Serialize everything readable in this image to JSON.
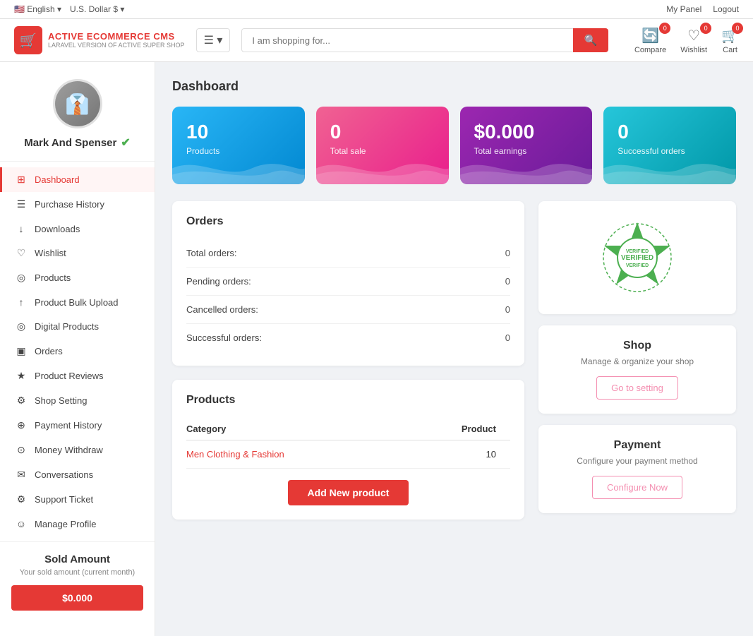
{
  "topbar": {
    "language": "English",
    "currency": "U.S. Dollar $",
    "my_panel": "My Panel",
    "logout": "Logout"
  },
  "header": {
    "brand": "ACTIVE ECOMMERCE CMS",
    "sub": "LARAVEL VERSION OF ACTIVE SUPER SHOP",
    "search_placeholder": "I am shopping for...",
    "compare_label": "Compare",
    "wishlist_label": "Wishlist",
    "cart_label": "Cart",
    "compare_count": "0",
    "wishlist_count": "0",
    "cart_count": "0"
  },
  "sidebar": {
    "username": "Mark And Spenser",
    "nav_items": [
      {
        "label": "Dashboard",
        "icon": "⊞",
        "active": true
      },
      {
        "label": "Purchase History",
        "icon": "☰",
        "active": false
      },
      {
        "label": "Downloads",
        "icon": "↓",
        "active": false
      },
      {
        "label": "Wishlist",
        "icon": "♡",
        "active": false
      },
      {
        "label": "Products",
        "icon": "◎",
        "active": false
      },
      {
        "label": "Product Bulk Upload",
        "icon": "↑",
        "active": false
      },
      {
        "label": "Digital Products",
        "icon": "◎",
        "active": false
      },
      {
        "label": "Orders",
        "icon": "▣",
        "active": false
      },
      {
        "label": "Product Reviews",
        "icon": "★",
        "active": false
      },
      {
        "label": "Shop Setting",
        "icon": "⚙",
        "active": false
      },
      {
        "label": "Payment History",
        "icon": "⊕",
        "active": false
      },
      {
        "label": "Money Withdraw",
        "icon": "⊙",
        "active": false
      },
      {
        "label": "Conversations",
        "icon": "✉",
        "active": false
      },
      {
        "label": "Support Ticket",
        "icon": "⚙",
        "active": false
      },
      {
        "label": "Manage Profile",
        "icon": "☺",
        "active": false
      }
    ],
    "sold_amount_title": "Sold Amount",
    "sold_amount_sub": "Your sold amount (current month)",
    "sold_amount_value": "$0.000"
  },
  "dashboard": {
    "title": "Dashboard",
    "stat_cards": [
      {
        "num": "10",
        "label": "Products",
        "color": "blue"
      },
      {
        "num": "0",
        "label": "Total sale",
        "color": "pink"
      },
      {
        "num": "$0.000",
        "label": "Total earnings",
        "color": "purple"
      },
      {
        "num": "0",
        "label": "Successful orders",
        "color": "teal"
      }
    ],
    "orders": {
      "title": "Orders",
      "rows": [
        {
          "label": "Total orders:",
          "value": "0"
        },
        {
          "label": "Pending orders:",
          "value": "0"
        },
        {
          "label": "Cancelled orders:",
          "value": "0"
        },
        {
          "label": "Successful orders:",
          "value": "0"
        }
      ]
    },
    "products": {
      "title": "Products",
      "col_category": "Category",
      "col_product": "Product",
      "rows": [
        {
          "category": "Men Clothing & Fashion",
          "count": "10"
        }
      ],
      "add_btn": "Add New product"
    },
    "verified_badge": {
      "line1": "VERIFIED",
      "line2": "VERIFIED",
      "line3": "VERIFIED"
    },
    "shop_card": {
      "title": "Shop",
      "sub": "Manage & organize your shop",
      "btn": "Go to setting"
    },
    "payment_card": {
      "title": "Payment",
      "sub": "Configure your payment method",
      "btn": "Configure Now"
    }
  }
}
